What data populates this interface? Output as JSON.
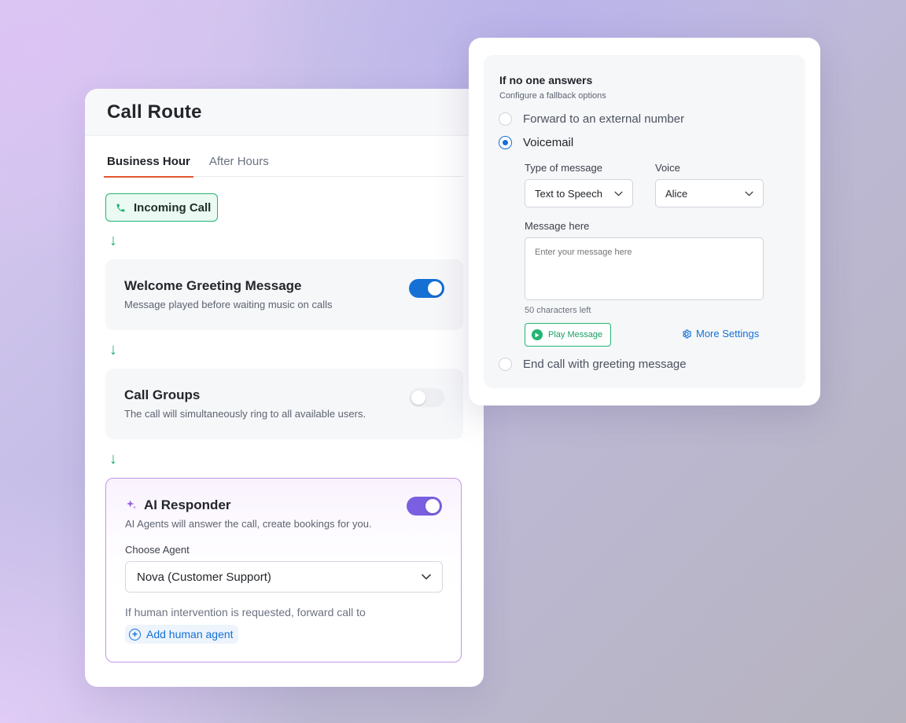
{
  "route": {
    "title": "Call Route",
    "tabs": [
      {
        "label": "Business Hour",
        "active": true
      },
      {
        "label": "After Hours",
        "active": false
      }
    ],
    "incoming": {
      "label": "Incoming Call",
      "icon": "phone-icon"
    },
    "arrow": "↓",
    "steps": [
      {
        "title": "Welcome Greeting Message",
        "desc": "Message played before waiting music on calls",
        "enabled": true
      },
      {
        "title": "Call Groups",
        "desc": "The call will simultaneously ring to all available users.",
        "enabled": false
      }
    ],
    "ai": {
      "title": "AI Responder",
      "desc": "AI Agents will answer the call, create bookings for you.",
      "enabled": true,
      "choose_label": "Choose Agent",
      "agent_value": "Nova (Customer Support)",
      "forward_text": "If human intervention is requested, forward call to",
      "add_agent_label": "Add human agent"
    }
  },
  "fallback": {
    "title": "If no one answers",
    "subtitle": "Configure a fallback options",
    "options": [
      {
        "label": "Forward to an external number",
        "checked": false
      },
      {
        "label": "Voicemail",
        "checked": true
      },
      {
        "label": "End call with greeting message",
        "checked": false
      }
    ],
    "voicemail": {
      "type_label": "Type of message",
      "type_value": "Text to Speech",
      "voice_label": "Voice",
      "voice_value": "Alice",
      "message_label": "Message here",
      "message_placeholder": "Enter your message here",
      "chars_left": "50 characters left",
      "play_label": "Play Message",
      "more_settings_label": "More Settings"
    }
  },
  "colors": {
    "accent_blue": "#1570d6",
    "green": "#22b573",
    "purple": "#7a5fe0",
    "tab_underline": "#e4572e"
  }
}
